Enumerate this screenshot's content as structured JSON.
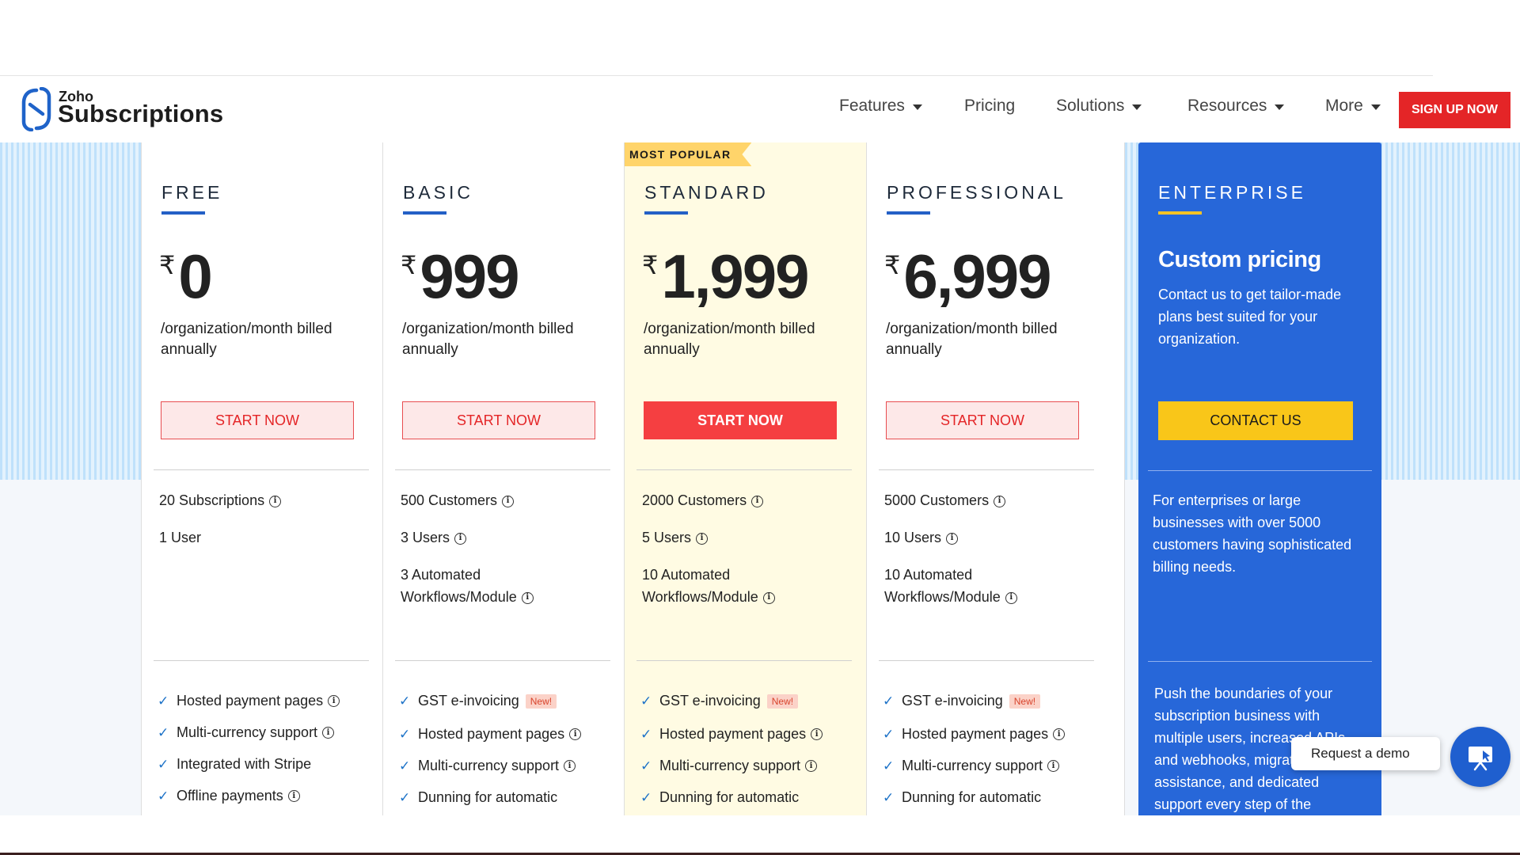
{
  "header": {
    "logo_small": "Zoho",
    "logo_large": "Subscriptions",
    "nav": [
      {
        "label": "Features",
        "dropdown": true
      },
      {
        "label": "Pricing",
        "dropdown": false
      },
      {
        "label": "Solutions",
        "dropdown": true
      },
      {
        "label": "Resources",
        "dropdown": true
      },
      {
        "label": "More",
        "dropdown": true
      }
    ],
    "signup_label": "SIGN UP NOW"
  },
  "currency_symbol": "₹",
  "plans": [
    {
      "name": "FREE",
      "price": "0",
      "billed": "/organization/month billed annually",
      "cta": "START NOW",
      "limits": [
        "20 Subscriptions",
        "1 User"
      ],
      "features": [
        "Hosted payment pages",
        "Multi-currency support",
        "Integrated with Stripe",
        "Offline payments"
      ]
    },
    {
      "name": "BASIC",
      "price": "999",
      "billed": "/organization/month billed annually",
      "cta": "START NOW",
      "limits": [
        "500 Customers",
        "3 Users",
        "3 Automated Workflows/Module"
      ],
      "features": [
        "GST e-invoicing",
        "Hosted payment pages",
        "Multi-currency support",
        "Dunning for automatic"
      ]
    },
    {
      "name": "STANDARD",
      "price": "1,999",
      "billed": "/organization/month billed annually",
      "cta": "START NOW",
      "ribbon": "MOST POPULAR",
      "limits": [
        "2000 Customers",
        "5 Users",
        "10 Automated Workflows/Module"
      ],
      "features": [
        "GST e-invoicing",
        "Hosted payment pages",
        "Multi-currency support",
        "Dunning for automatic"
      ]
    },
    {
      "name": "PROFESSIONAL",
      "price": "6,999",
      "billed": "/organization/month billed annually",
      "cta": "START NOW",
      "limits": [
        "5000 Customers",
        "10 Users",
        "10 Automated Workflows/Module"
      ],
      "features": [
        "GST e-invoicing",
        "Hosted payment pages",
        "Multi-currency support",
        "Dunning for automatic"
      ]
    }
  ],
  "new_badge": "New!",
  "enterprise": {
    "name": "ENTERPRISE",
    "title": "Custom pricing",
    "desc": "Contact us to get tailor-made plans best suited for your organization.",
    "cta": "CONTACT US",
    "limits_text": "For enterprises or large businesses with over 5000 customers having sophisticated billing needs.",
    "features_text": "Push the boundaries of your subscription business with multiple users, increased APIs and webhooks, migration assistance, and dedicated support every step of the"
  },
  "demo": {
    "label": "Request a demo"
  },
  "colors": {
    "brand_red": "#e42527",
    "enterprise_blue": "#2767d9",
    "accent_yellow": "#f9c619",
    "check_blue": "#1e73c8"
  }
}
